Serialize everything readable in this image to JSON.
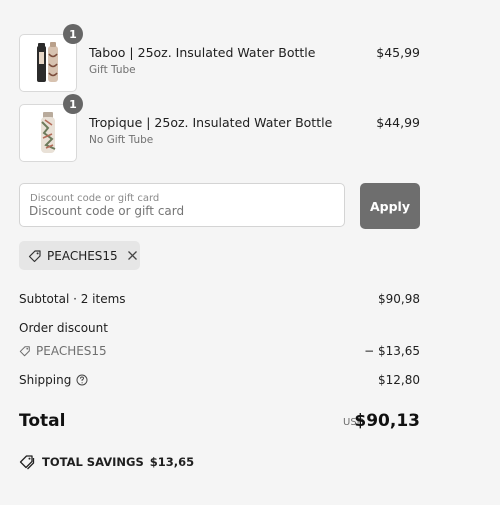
{
  "line_items": [
    {
      "name": "Taboo | 25oz. Insulated Water Bottle",
      "variant": "Gift Tube",
      "price": "$45,99",
      "quantity": "1"
    },
    {
      "name": "Tropique | 25oz. Insulated Water Bottle",
      "variant": "No Gift Tube",
      "price": "$44,99",
      "quantity": "1"
    }
  ],
  "discount": {
    "field_label": "Discount code or gift card",
    "placeholder": "Discount code or gift card",
    "apply_label": "Apply",
    "applied_code": "PEACHES15"
  },
  "summary": {
    "subtotal_label": "Subtotal · 2 items",
    "subtotal_value": "$90,98",
    "order_discount_label": "Order discount",
    "order_discount_code": "PEACHES15",
    "order_discount_value": "− $13,65",
    "shipping_label": "Shipping",
    "shipping_value": "$12,80",
    "total_label": "Total",
    "total_currency": "USD",
    "total_value": "$90,13",
    "savings_label": "TOTAL SAVINGS",
    "savings_value": "$13,65"
  },
  "colors": {
    "background": "#f5f5f5",
    "apply_button": "#6e6e6e",
    "quantity_badge": "#666666",
    "chip_background": "#e6e6e6"
  }
}
